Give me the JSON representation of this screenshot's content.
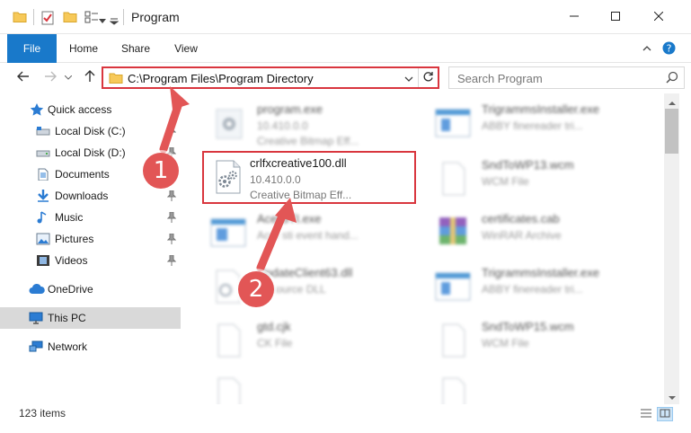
{
  "window": {
    "title": "Program",
    "minimize_icon": "minimize-icon",
    "maximize_icon": "maximize-icon",
    "close_icon": "close-icon"
  },
  "ribbon": {
    "tabs": [
      "File",
      "Home",
      "Share",
      "View"
    ]
  },
  "address": {
    "path": "C:\\Program Files\\Program Directory"
  },
  "search": {
    "placeholder": "Search Program"
  },
  "sidebar": {
    "items": [
      {
        "label": "Quick access",
        "icon": "star-icon"
      },
      {
        "label": "Local Disk (C:)",
        "icon": "drive-icon"
      },
      {
        "label": "Local Disk (D:)",
        "icon": "drive-icon"
      },
      {
        "label": "Documents",
        "icon": "documents-icon"
      },
      {
        "label": "Downloads",
        "icon": "download-icon"
      },
      {
        "label": "Music",
        "icon": "music-icon"
      },
      {
        "label": "Pictures",
        "icon": "pictures-icon"
      },
      {
        "label": "Videos",
        "icon": "videos-icon"
      },
      {
        "label": "OneDrive",
        "icon": "cloud-icon"
      },
      {
        "label": "This PC",
        "icon": "computer-icon"
      },
      {
        "label": "Network",
        "icon": "network-icon"
      }
    ]
  },
  "files": [
    {
      "name": "program.exe",
      "line2": "10.410.0.0",
      "line3": "Creative Bitmap Eff..."
    },
    {
      "name": "TrigrammsInstaller.exe",
      "line2": "ABBY finereader tri...",
      "line3": ""
    },
    {
      "name": "crlfxcreative100.dll",
      "line2": "10.410.0.0",
      "line3": "Creative Bitmap Eff..."
    },
    {
      "name": "SndToWP13.wcm",
      "line2": "WCM File",
      "line3": ""
    },
    {
      "name": "AcerSTI.exe",
      "line2": "Acer sti event hand...",
      "line3": ""
    },
    {
      "name": "certificates.cab",
      "line2": "WinRAR Archive",
      "line3": ""
    },
    {
      "name": "UpdateClient63.dll",
      "line2": "Resource DLL",
      "line3": ""
    },
    {
      "name": "TrigrammsInstaller.exe",
      "line2": "ABBY finereader tri...",
      "line3": ""
    },
    {
      "name": "gtd.cjk",
      "line2": "CK File",
      "line3": ""
    },
    {
      "name": "SndToWP15.wcm",
      "line2": "WCM File",
      "line3": ""
    }
  ],
  "status": {
    "count": "123 items"
  },
  "callouts": [
    "1",
    "2"
  ],
  "colors": {
    "accent": "#1979ca",
    "highlight": "#d9363e",
    "callout": "#e25656"
  }
}
